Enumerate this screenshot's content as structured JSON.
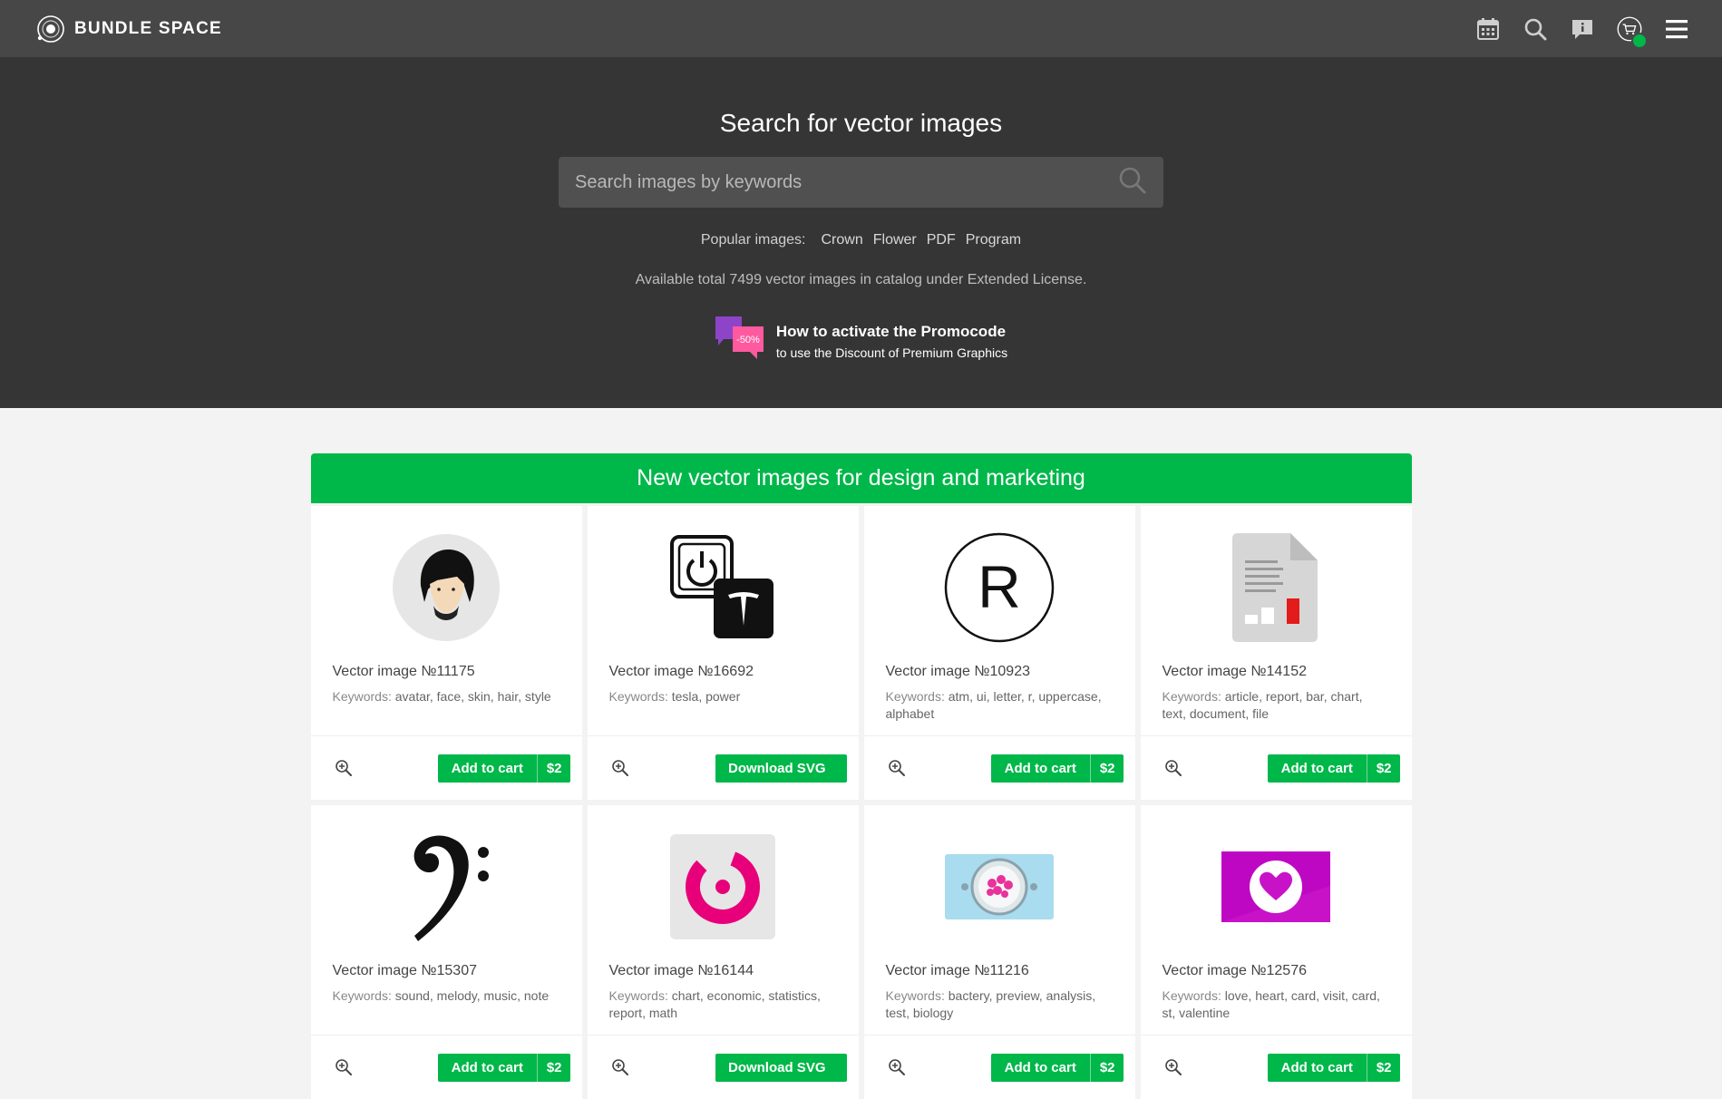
{
  "brand": {
    "name": "BUNDLE SPACE"
  },
  "topbar": {
    "icons": [
      "calendar-icon",
      "search-icon",
      "info-icon",
      "cart-icon",
      "menu-icon"
    ],
    "cart_status_color": "#00b74a"
  },
  "hero": {
    "title": "Search for vector images",
    "search_placeholder": "Search images by keywords",
    "popular_label": "Popular images:",
    "popular": [
      "Crown",
      "Flower",
      "PDF",
      "Program"
    ],
    "total": "Available total 7499 vector images in catalog under Extended License.",
    "promo_badge": "-50%",
    "promo_title": "How to activate the Promocode",
    "promo_subtitle": "to use the Discount of Premium Graphics"
  },
  "section": {
    "title": "New vector images for design and marketing",
    "accent": "#00b74a"
  },
  "labels": {
    "keywords": "Keywords:",
    "add_to_cart": "Add to cart",
    "download": "Download SVG"
  },
  "cards": [
    {
      "title": "Vector image №11175",
      "keywords": "avatar, face, skin, hair, style",
      "action": "cart",
      "price": "$2",
      "icon": "avatar-face-icon"
    },
    {
      "title": "Vector image №16692",
      "keywords": "tesla, power",
      "action": "download",
      "icon": "tesla-power-icon"
    },
    {
      "title": "Vector image №10923",
      "keywords": "atm, ui, letter, r, uppercase, alphabet",
      "action": "cart",
      "price": "$2",
      "icon": "letter-r-icon"
    },
    {
      "title": "Vector image №14152",
      "keywords": "article, report, bar, chart, text, document, file",
      "action": "cart",
      "price": "$2",
      "icon": "document-chart-icon"
    },
    {
      "title": "Vector image №15307",
      "keywords": "sound, melody, music, note",
      "action": "cart",
      "price": "$2",
      "icon": "bass-clef-icon"
    },
    {
      "title": "Vector image №16144",
      "keywords": "chart, economic, statistics, report, math",
      "action": "download",
      "icon": "donut-chart-icon"
    },
    {
      "title": "Vector image №11216",
      "keywords": "bactery, preview, analysis, test, biology",
      "action": "cart",
      "price": "$2",
      "icon": "petri-dish-icon"
    },
    {
      "title": "Vector image №12576",
      "keywords": "love, heart, card, visit, card, st, valentine",
      "action": "cart",
      "price": "$2",
      "icon": "heart-card-icon"
    }
  ]
}
